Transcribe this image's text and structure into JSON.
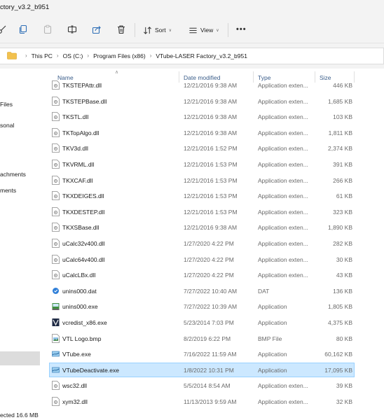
{
  "window": {
    "title": "ctory_v3.2_b951"
  },
  "toolbar": {
    "sort_label": "Sort",
    "view_label": "View"
  },
  "address": {
    "crumbs": [
      "This PC",
      "OS (C:)",
      "Program Files (x86)",
      "VTube-LASER Factory_v3.2_b951"
    ]
  },
  "nav": {
    "items": [
      {
        "label": "Files"
      },
      {
        "label": "sonal"
      },
      {
        "label": "achments"
      },
      {
        "label": "ments"
      }
    ],
    "status": "ected  16.6 MB"
  },
  "columns": {
    "name": "Name",
    "date": "Date modified",
    "type": "Type",
    "size": "Size"
  },
  "files": [
    {
      "name": "TKSTEPAttr.dll",
      "date": "12/21/2016 9:38 AM",
      "type": "Application exten...",
      "size": "446 KB",
      "icon": "dll-icon"
    },
    {
      "name": "TKSTEPBase.dll",
      "date": "12/21/2016 9:38 AM",
      "type": "Application exten...",
      "size": "1,685 KB",
      "icon": "dll-icon"
    },
    {
      "name": "TKSTL.dll",
      "date": "12/21/2016 9:38 AM",
      "type": "Application exten...",
      "size": "103 KB",
      "icon": "dll-icon"
    },
    {
      "name": "TKTopAlgo.dll",
      "date": "12/21/2016 9:38 AM",
      "type": "Application exten...",
      "size": "1,811 KB",
      "icon": "dll-icon"
    },
    {
      "name": "TKV3d.dll",
      "date": "12/21/2016 1:52 PM",
      "type": "Application exten...",
      "size": "2,374 KB",
      "icon": "dll-icon"
    },
    {
      "name": "TKVRML.dll",
      "date": "12/21/2016 1:53 PM",
      "type": "Application exten...",
      "size": "391 KB",
      "icon": "dll-icon"
    },
    {
      "name": "TKXCAF.dll",
      "date": "12/21/2016 1:53 PM",
      "type": "Application exten...",
      "size": "266 KB",
      "icon": "dll-icon"
    },
    {
      "name": "TKXDEIGES.dll",
      "date": "12/21/2016 1:53 PM",
      "type": "Application exten...",
      "size": "61 KB",
      "icon": "dll-icon"
    },
    {
      "name": "TKXDESTEP.dll",
      "date": "12/21/2016 1:53 PM",
      "type": "Application exten...",
      "size": "323 KB",
      "icon": "dll-icon"
    },
    {
      "name": "TKXSBase.dll",
      "date": "12/21/2016 9:38 AM",
      "type": "Application exten...",
      "size": "1,890 KB",
      "icon": "dll-icon"
    },
    {
      "name": "uCalc32v400.dll",
      "date": "1/27/2020 4:22 PM",
      "type": "Application exten...",
      "size": "282 KB",
      "icon": "dll-icon"
    },
    {
      "name": "uCalc64v400.dll",
      "date": "1/27/2020 4:22 PM",
      "type": "Application exten...",
      "size": "30 KB",
      "icon": "dll-icon"
    },
    {
      "name": "uCalcLBx.dll",
      "date": "1/27/2020 4:22 PM",
      "type": "Application exten...",
      "size": "43 KB",
      "icon": "dll-icon"
    },
    {
      "name": "unins000.dat",
      "date": "7/27/2022 10:40 AM",
      "type": "DAT",
      "size": "136 KB",
      "icon": "dat-icon"
    },
    {
      "name": "unins000.exe",
      "date": "7/27/2022 10:39 AM",
      "type": "Application",
      "size": "1,805 KB",
      "icon": "installer-icon"
    },
    {
      "name": "vcredist_x86.exe",
      "date": "5/23/2014 7:03 PM",
      "type": "Application",
      "size": "4,375 KB",
      "icon": "vcredist-icon"
    },
    {
      "name": "VTL Logo.bmp",
      "date": "8/2/2019 6:22 PM",
      "type": "BMP File",
      "size": "80 KB",
      "icon": "bmp-icon"
    },
    {
      "name": "VTube.exe",
      "date": "7/16/2022 11:59 AM",
      "type": "Application",
      "size": "60,162 KB",
      "icon": "vtube-icon"
    },
    {
      "name": "VTubeDeactivate.exe",
      "date": "1/8/2022 10:31 PM",
      "type": "Application",
      "size": "17,095 KB",
      "icon": "vtube-icon",
      "selected": true
    },
    {
      "name": "wsc32.dll",
      "date": "5/5/2014 8:54 AM",
      "type": "Application exten...",
      "size": "39 KB",
      "icon": "dll-icon"
    },
    {
      "name": "xym32.dll",
      "date": "11/13/2013 9:59 AM",
      "type": "Application exten...",
      "size": "32 KB",
      "icon": "dll-icon"
    }
  ]
}
